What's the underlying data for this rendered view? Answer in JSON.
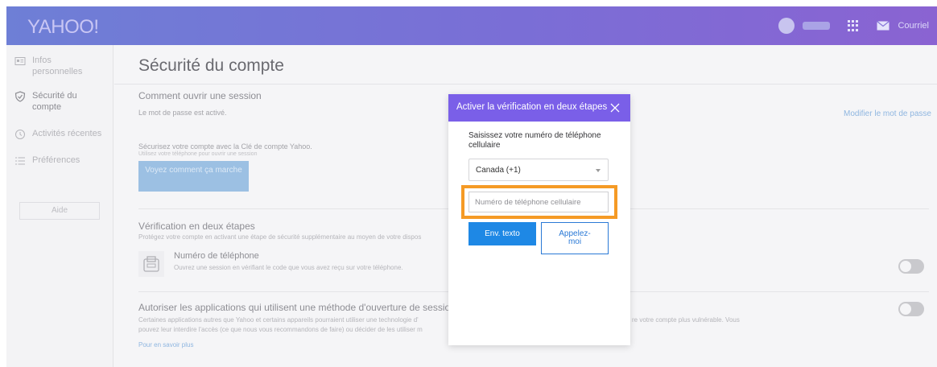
{
  "header": {
    "logo": "YAHOO!",
    "mail_label": "Courriel"
  },
  "sidebar": {
    "items": [
      {
        "label": "Infos personnelles",
        "icon": "id-card-icon"
      },
      {
        "label": "Sécurité du compte",
        "icon": "shield-icon"
      },
      {
        "label": "Activités récentes",
        "icon": "clock-icon"
      },
      {
        "label": "Préférences",
        "icon": "list-icon"
      }
    ],
    "help_label": "Aide"
  },
  "main": {
    "title": "Sécurité du compte",
    "signin": {
      "title": "Comment ouvrir une session",
      "password_status": "Le mot de passe est activé.",
      "change_password_link": "Modifier le mot de passe",
      "account_key_text": "Sécurisez votre compte avec la Clé de compte Yahoo.",
      "account_key_hint": "Utilisez votre téléphone pour ouvrir une session",
      "see_how_button": "Voyez comment ça marche"
    },
    "two_step": {
      "title": "Vérification en deux étapes",
      "description": "Protégez votre compte en activant une étape de sécurité supplémentaire au moyen de votre dispos",
      "phone_title": "Numéro de téléphone",
      "phone_text": "Ouvrez une session en vérifiant le code que vous avez reçu sur votre téléphone.",
      "toggle_on": false
    },
    "apps": {
      "title": "Autoriser les applications qui utilisent une méthode d'ouverture de session m",
      "description_1": "Certaines applications autres que Yahoo et certains appareils pourraient utiliser une technologie d'",
      "description_1_end": "re votre compte plus vulnérable. Vous",
      "description_2": "pouvez leur interdire l'accès (ce que nous vous recommandons de faire) ou décider de les utiliser m",
      "learn_more": "Pour en savoir plus",
      "toggle_on": false
    }
  },
  "modal": {
    "title": "Activer la vérification en deux étapes",
    "instruction": "Saisissez votre numéro de téléphone cellulaire",
    "country": "Canada (+1)",
    "phone_placeholder": "Numéro de téléphone cellulaire",
    "send_text_button": "Env. texto",
    "call_me_button": "Appelez-moi"
  },
  "colors": {
    "header_start": "#6e7fd6",
    "header_end": "#8a63d2",
    "modal_header": "#7a5fe8",
    "primary_button": "#1e88e5",
    "highlight": "#f59a25"
  }
}
